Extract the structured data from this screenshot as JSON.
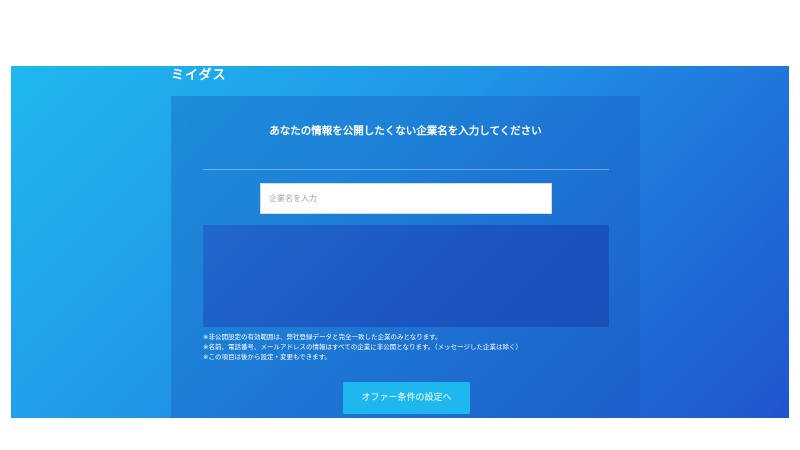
{
  "app": {
    "logo_text": "ミイダス"
  },
  "panel": {
    "heading": "あなたの情報を公開したくない企業名を入力してください",
    "search": {
      "placeholder": "企業名を入力",
      "value": ""
    },
    "notes": [
      "※非公開設定の有効範囲は、弊社登録データと完全一致した企業のみとなります。",
      "※名前、電話番号、メールアドレスの情報はすべての企業に非公開となります。（メッセージした企業は除く）",
      "※この項目は後から設定・変更もできます。"
    ],
    "submit_label": "オファー条件の設定へ"
  },
  "colors": {
    "gradient_start": "#1fb8ef",
    "gradient_end": "#1f55cf",
    "button": "#1fb8ee",
    "text": "#ffffff"
  }
}
